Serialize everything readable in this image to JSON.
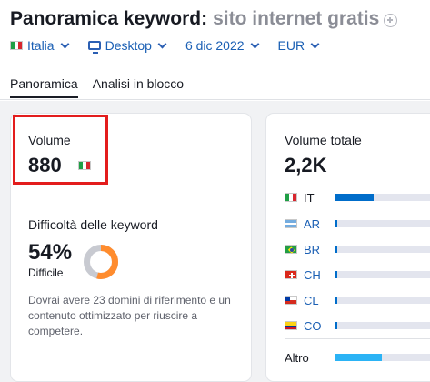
{
  "header": {
    "title_prefix": "Panoramica keyword:",
    "keyword": "sito internet gratis"
  },
  "filters": {
    "country": "Italia",
    "device": "Desktop",
    "date": "6 dic 2022",
    "currency": "EUR"
  },
  "tabs": [
    {
      "label": "Panoramica",
      "active": true
    },
    {
      "label": "Analisi in blocco",
      "active": false
    }
  ],
  "volume": {
    "label": "Volume",
    "value": "880"
  },
  "keyword_difficulty": {
    "label": "Difficoltà delle keyword",
    "value": "54%",
    "percent": 54,
    "level": "Difficile",
    "description": "Dovrai avere 23 domini di riferimento e un contenuto ottimizzato per riuscire a competere."
  },
  "global_volume": {
    "label": "Volume totale",
    "value": "2,2K",
    "countries": [
      {
        "code": "IT",
        "link": false,
        "share": 0.38,
        "color": "#006dca"
      },
      {
        "code": "AR",
        "link": true,
        "share": 0.02,
        "color": "#006dca"
      },
      {
        "code": "BR",
        "link": true,
        "share": 0.02,
        "color": "#006dca"
      },
      {
        "code": "CH",
        "link": true,
        "share": 0.02,
        "color": "#006dca"
      },
      {
        "code": "CL",
        "link": true,
        "share": 0.02,
        "color": "#006dca"
      },
      {
        "code": "CO",
        "link": true,
        "share": 0.02,
        "color": "#006dca"
      }
    ],
    "other": {
      "label": "Altro",
      "share": 0.46,
      "color": "#2bb3f5"
    }
  },
  "colors": {
    "accent": "#1a5fb4",
    "highlight_box": "#e31d1d",
    "difficulty_fill": "#ff8c2e",
    "difficulty_track": "#c8cad1"
  }
}
